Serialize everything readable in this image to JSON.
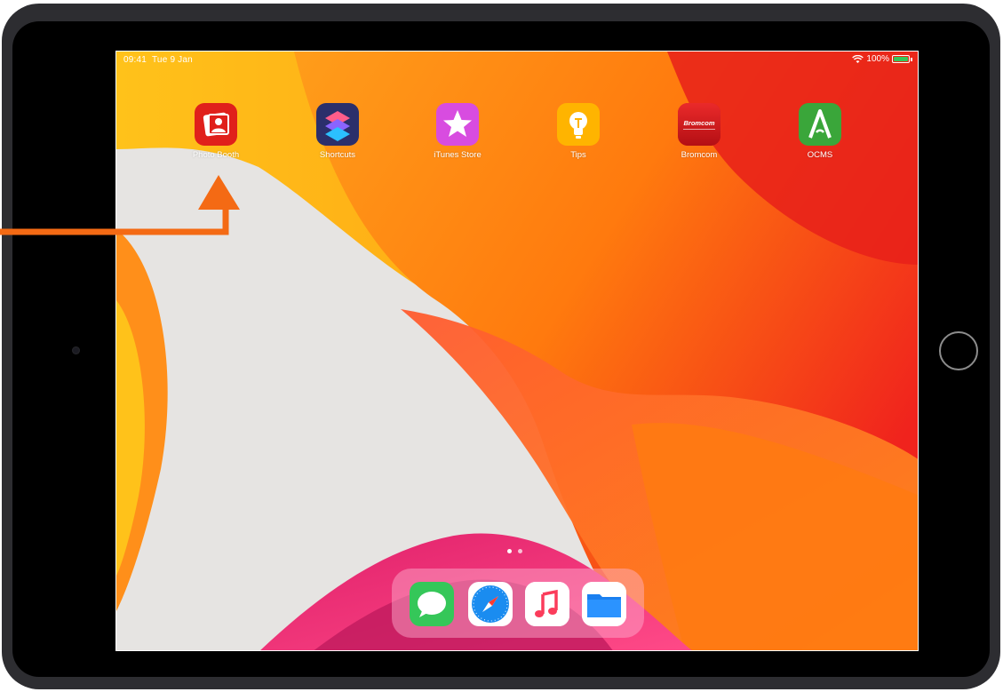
{
  "status_bar": {
    "time": "09:41",
    "date": "Tue 9 Jan",
    "battery": "100%"
  },
  "apps": [
    {
      "label": "Photo Booth",
      "icon": "photo-booth-icon",
      "color": "#e0201b"
    },
    {
      "label": "Shortcuts",
      "icon": "shortcuts-icon",
      "color": "#2b2f6b"
    },
    {
      "label": "iTunes Store",
      "icon": "itunes-store-icon",
      "color": "#d84ce0"
    },
    {
      "label": "Tips",
      "icon": "tips-icon",
      "color": "#ffb400"
    },
    {
      "label": "Bromcom",
      "icon": "bromcom-icon",
      "color": "#d8141c",
      "icon_text": "Bromcom"
    },
    {
      "label": "OCMS",
      "icon": "ocms-icon",
      "color": "#3aa63a"
    }
  ],
  "dock": [
    {
      "icon": "messages-icon",
      "color": "#35c759"
    },
    {
      "icon": "safari-icon",
      "color": "#1a8cf0"
    },
    {
      "icon": "music-icon",
      "color": "#fb3c5b"
    },
    {
      "icon": "files-icon",
      "color": "#1a7ff0"
    }
  ],
  "annotation": {
    "arrow_color": "#f46a14",
    "points_to": "Photo Booth"
  }
}
